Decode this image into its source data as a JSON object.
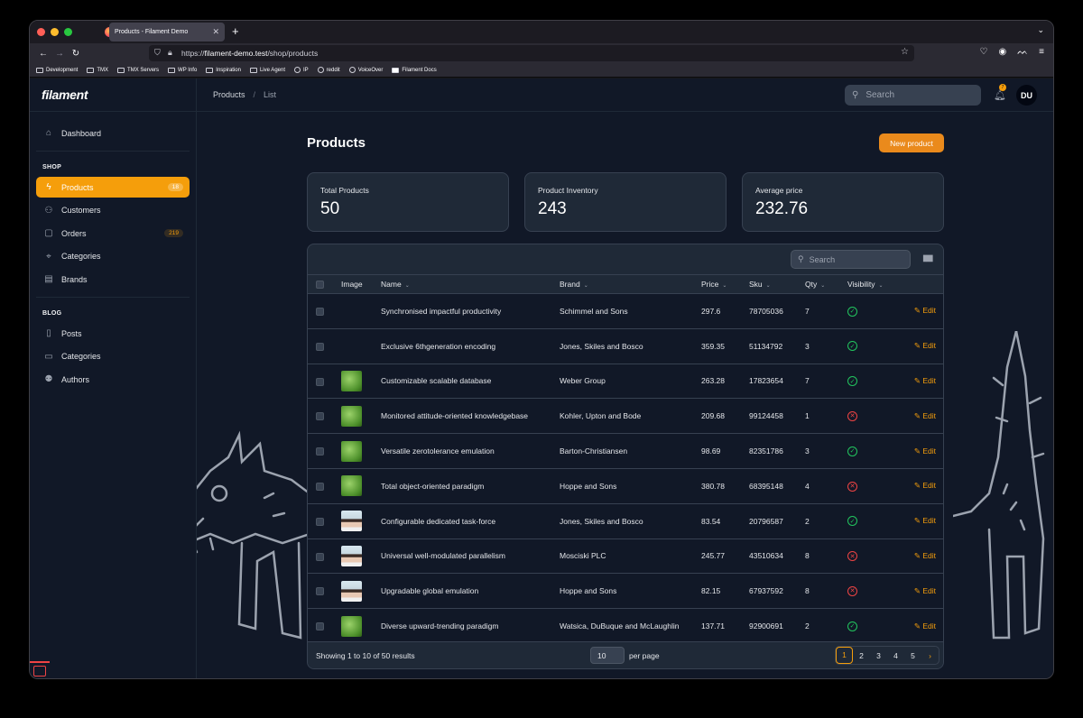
{
  "browser": {
    "tab_title": "Products - Filament Demo",
    "url_prefix": "https://",
    "url_host": "filament-demo.test",
    "url_path": "/shop/products",
    "bookmarks": [
      "Development",
      "TMX",
      "TMX Servers",
      "WP Info",
      "Inspiration",
      "Live Agent",
      "IP",
      "reddit",
      "VoiceOver",
      "Filament Docs"
    ]
  },
  "app": {
    "logo": "filament",
    "breadcrumb": [
      "Products",
      "List"
    ],
    "search_placeholder": "Search",
    "notification_count": "7",
    "avatar_initials": "DU"
  },
  "sidebar": {
    "dashboard": "Dashboard",
    "shop_label": "SHOP",
    "shop_items": [
      {
        "label": "Products",
        "badge": "18",
        "icon": "bolt-icon"
      },
      {
        "label": "Customers",
        "badge": "",
        "icon": "users-icon"
      },
      {
        "label": "Orders",
        "badge": "219",
        "icon": "shopping-bag-icon"
      },
      {
        "label": "Categories",
        "badge": "",
        "icon": "tag-icon"
      },
      {
        "label": "Brands",
        "badge": "",
        "icon": "book-icon"
      }
    ],
    "blog_label": "BLOG",
    "blog_items": [
      {
        "label": "Posts",
        "icon": "document-icon"
      },
      {
        "label": "Categories",
        "icon": "folder-icon"
      },
      {
        "label": "Authors",
        "icon": "user-group-icon"
      }
    ]
  },
  "page": {
    "title": "Products",
    "new_button": "New product",
    "stats": [
      {
        "label": "Total Products",
        "value": "50"
      },
      {
        "label": "Product Inventory",
        "value": "243"
      },
      {
        "label": "Average price",
        "value": "232.76"
      }
    ]
  },
  "table": {
    "search_placeholder": "Search",
    "columns": {
      "image": "Image",
      "name": "Name",
      "brand": "Brand",
      "price": "Price",
      "sku": "Sku",
      "qty": "Qty",
      "visibility": "Visibility"
    },
    "edit_label": "Edit",
    "rows": [
      {
        "image": "none",
        "name": "Synchronised impactful productivity",
        "brand": "Schimmel and Sons",
        "price": "297.6",
        "sku": "78705036",
        "qty": "7",
        "visible": true
      },
      {
        "image": "none",
        "name": "Exclusive 6thgeneration encoding",
        "brand": "Jones, Skiles and Bosco",
        "price": "359.35",
        "sku": "51134792",
        "qty": "3",
        "visible": true
      },
      {
        "image": "grass",
        "name": "Customizable scalable database",
        "brand": "Weber Group",
        "price": "263.28",
        "sku": "17823654",
        "qty": "7",
        "visible": true
      },
      {
        "image": "grass",
        "name": "Monitored attitude-oriented knowledgebase",
        "brand": "Kohler, Upton and Bode",
        "price": "209.68",
        "sku": "99124458",
        "qty": "1",
        "visible": false
      },
      {
        "image": "grass",
        "name": "Versatile zerotolerance emulation",
        "brand": "Barton-Christiansen",
        "price": "98.69",
        "sku": "82351786",
        "qty": "3",
        "visible": true
      },
      {
        "image": "grass",
        "name": "Total object-oriented paradigm",
        "brand": "Hoppe and Sons",
        "price": "380.78",
        "sku": "68395148",
        "qty": "4",
        "visible": false
      },
      {
        "image": "person",
        "name": "Configurable dedicated task-force",
        "brand": "Jones, Skiles and Bosco",
        "price": "83.54",
        "sku": "20796587",
        "qty": "2",
        "visible": true
      },
      {
        "image": "person",
        "name": "Universal well-modulated parallelism",
        "brand": "Mosciski PLC",
        "price": "245.77",
        "sku": "43510634",
        "qty": "8",
        "visible": false
      },
      {
        "image": "person",
        "name": "Upgradable global emulation",
        "brand": "Hoppe and Sons",
        "price": "82.15",
        "sku": "67937592",
        "qty": "8",
        "visible": false
      },
      {
        "image": "grass",
        "name": "Diverse upward-trending paradigm",
        "brand": "Watsica, DuBuque and McLaughlin",
        "price": "137.71",
        "sku": "92900691",
        "qty": "2",
        "visible": true
      }
    ],
    "footer": {
      "showing": "Showing 1 to 10 of 50 results",
      "per_page_value": "10",
      "per_page_label": "per page",
      "pages": [
        "1",
        "2",
        "3",
        "4",
        "5"
      ],
      "current_page": "1"
    }
  },
  "colors": {
    "accent": "#f59e0b",
    "success": "#22c55e",
    "danger": "#ef4444",
    "background": "#111827"
  }
}
